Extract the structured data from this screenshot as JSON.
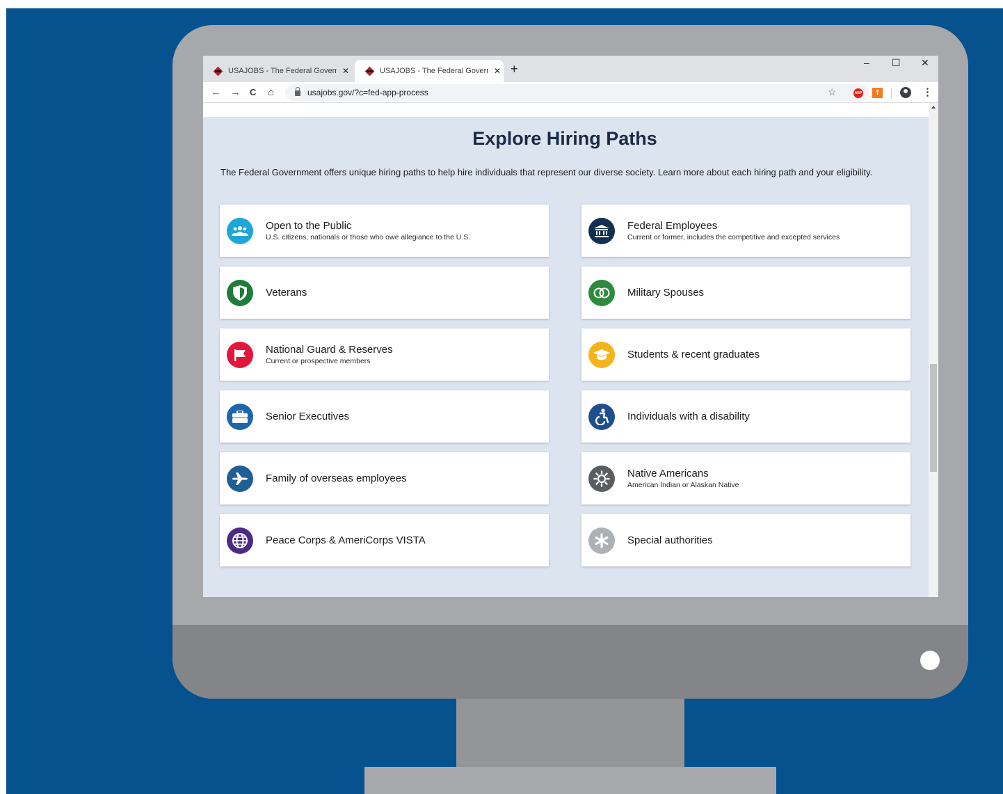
{
  "browser": {
    "tabs": [
      {
        "title": "USAJOBS - The Federal Governm",
        "active": false
      },
      {
        "title": "USAJOBS - The Federal Governm",
        "active": true
      }
    ],
    "new_tab": "+",
    "tab_close": "✕",
    "window_controls": {
      "minimize": "–",
      "maximize": "☐",
      "close": "✕"
    },
    "nav": {
      "back": "←",
      "forward": "→",
      "reload": "C",
      "home": "⌂"
    },
    "url": "usajobs.gov/?c=fed-app-process",
    "bookmark_icon": "☆",
    "extensions": {
      "abp": "ABP",
      "orange": "f"
    },
    "menu": "⋮"
  },
  "page": {
    "title": "Explore Hiring Paths",
    "intro": "The Federal Government offers unique hiring paths to help hire individuals that represent our diverse society. Learn more about each hiring path and your eligibility."
  },
  "hiring_paths": [
    {
      "label": "Open to the Public",
      "sub": "U.S. citizens, nationals or those who owe allegiance to the U.S.",
      "icon": "people-icon",
      "color": "#1fa6d8"
    },
    {
      "label": "Federal Employees",
      "sub": "Current or former, includes the competitive and excepted services",
      "icon": "building-icon",
      "color": "#112f4e"
    },
    {
      "label": "Veterans",
      "sub": "",
      "icon": "shield-icon",
      "color": "#1e7d38"
    },
    {
      "label": "Military Spouses",
      "sub": "",
      "icon": "rings-icon",
      "color": "#2e8a3d"
    },
    {
      "label": "National Guard & Reserves",
      "sub": "Current or prospective members",
      "icon": "flag-icon",
      "color": "#e3173b"
    },
    {
      "label": "Students & recent graduates",
      "sub": "",
      "icon": "graduation-cap-icon",
      "color": "#f5b41a"
    },
    {
      "label": "Senior Executives",
      "sub": "",
      "icon": "briefcase-icon",
      "color": "#1d66ab"
    },
    {
      "label": "Individuals with a disability",
      "sub": "",
      "icon": "accessibility-icon",
      "color": "#1d4f8c"
    },
    {
      "label": "Family of overseas employees",
      "sub": "",
      "icon": "airplane-icon",
      "color": "#1e5f94"
    },
    {
      "label": "Native Americans",
      "sub": "American Indian or Alaskan Native",
      "icon": "sun-icon",
      "color": "#5b5d61"
    },
    {
      "label": "Peace Corps & AmeriCorps VISTA",
      "sub": "",
      "icon": "globe-icon",
      "color": "#4b2a87"
    },
    {
      "label": "Special authorities",
      "sub": "",
      "icon": "asterisk-icon",
      "color": "#adb0b5"
    }
  ]
}
